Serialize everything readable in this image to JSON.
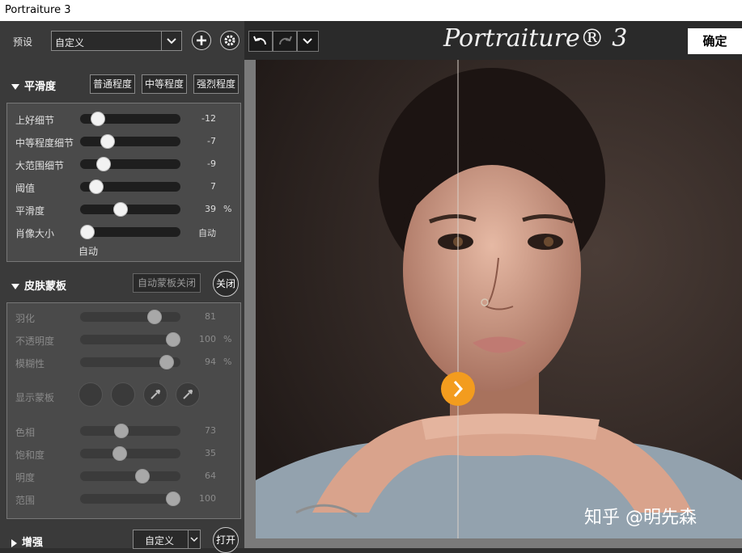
{
  "window": {
    "title": "Portraiture 3"
  },
  "left": {
    "preset": {
      "label": "预设",
      "value": "自定义"
    },
    "smoothing": {
      "title": "平滑度",
      "presets": [
        "普通程度",
        "中等程度",
        "强烈程度"
      ],
      "sliders": [
        {
          "label": "上好细节",
          "value": "-12",
          "unit": "",
          "level": 0.12
        },
        {
          "label": "中等程度细节",
          "value": "-7",
          "unit": "",
          "level": 0.24
        },
        {
          "label": "大范围细节",
          "value": "-9",
          "unit": "",
          "level": 0.19
        },
        {
          "label": "阈值",
          "value": "7",
          "unit": "",
          "level": 0.1
        },
        {
          "label": "平滑度",
          "value": "39",
          "unit": "%",
          "level": 0.39
        },
        {
          "label": "肖像大小",
          "value": "自动",
          "unit": "",
          "level": 0.0
        }
      ],
      "auto_caption": "自动"
    },
    "skinmask": {
      "title": "皮肤蒙板",
      "auto_button": "自动蒙板关闭",
      "toggle": "关闭",
      "sliders_top": [
        {
          "label": "羽化",
          "value": "81",
          "unit": "",
          "level": 0.78
        },
        {
          "label": "不透明度",
          "value": "100",
          "unit": "%",
          "level": 1.0
        },
        {
          "label": "模糊性",
          "value": "94",
          "unit": "%",
          "level": 0.92
        }
      ],
      "show_mask_label": "显示蒙板",
      "sliders_bottom": [
        {
          "label": "色相",
          "value": "73",
          "unit": "",
          "level": 0.4
        },
        {
          "label": "饱和度",
          "value": "35",
          "unit": "",
          "level": 0.38
        },
        {
          "label": "明度",
          "value": "64",
          "unit": "",
          "level": 0.64
        },
        {
          "label": "范围",
          "value": "100",
          "unit": "",
          "level": 1.0
        }
      ]
    },
    "enhance": {
      "title": "增强",
      "value": "自定义",
      "toggle": "打开"
    }
  },
  "topbar": {
    "logo": "Portraiture® 3",
    "ok": "确定"
  },
  "photo": {
    "watermark": "知乎 @明先森"
  },
  "colors": {
    "accent": "#f39c1e",
    "panel": "#3a3a3a"
  },
  "icons": [
    "add-icon",
    "gear-icon",
    "undo-icon",
    "redo-icon",
    "chevron-down-icon",
    "chevron-right-icon"
  ]
}
